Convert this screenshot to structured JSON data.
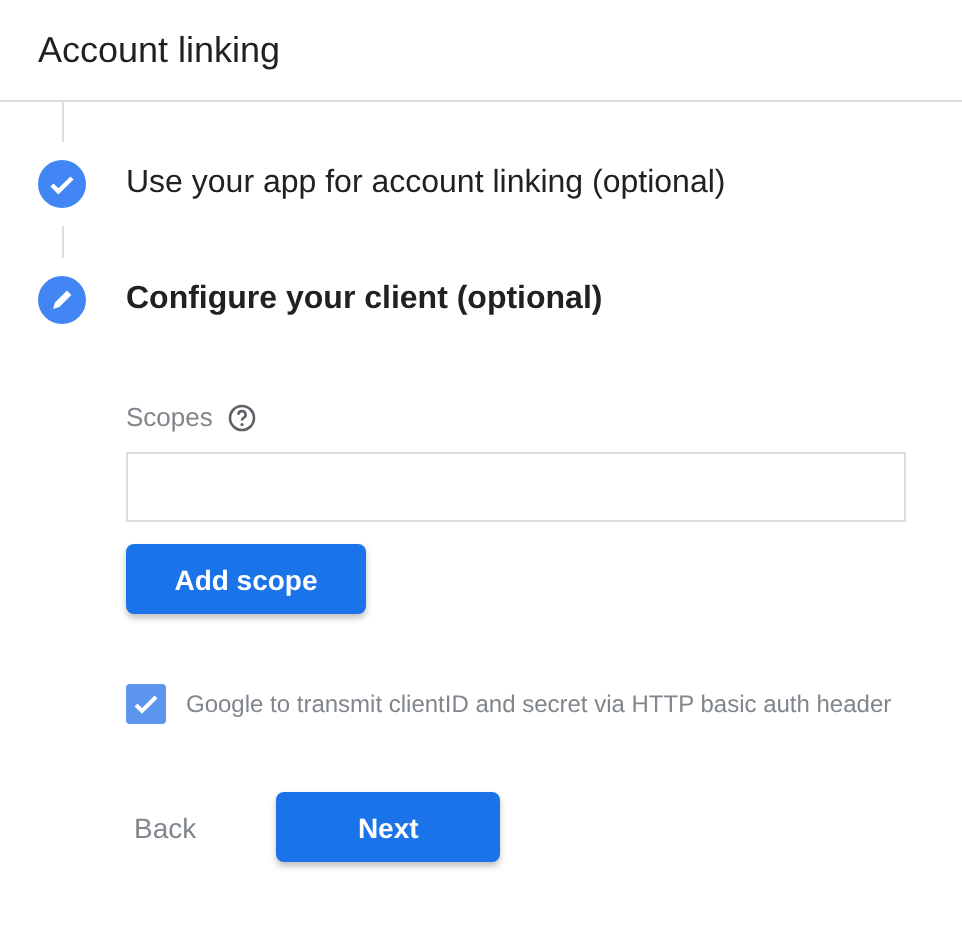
{
  "header": {
    "title": "Account linking"
  },
  "steps": [
    {
      "kind": "done",
      "label": "Use your app for account linking (optional)",
      "selected": false
    },
    {
      "kind": "edit",
      "label": "Configure your client (optional)",
      "selected": true
    }
  ],
  "scopes": {
    "label": "Scopes",
    "add_button": "Add scope"
  },
  "auth_option": {
    "label": "Google to transmit clientID and secret via HTTP basic auth header",
    "checked": true
  },
  "buttons": {
    "back": "Back",
    "next": "Next"
  }
}
